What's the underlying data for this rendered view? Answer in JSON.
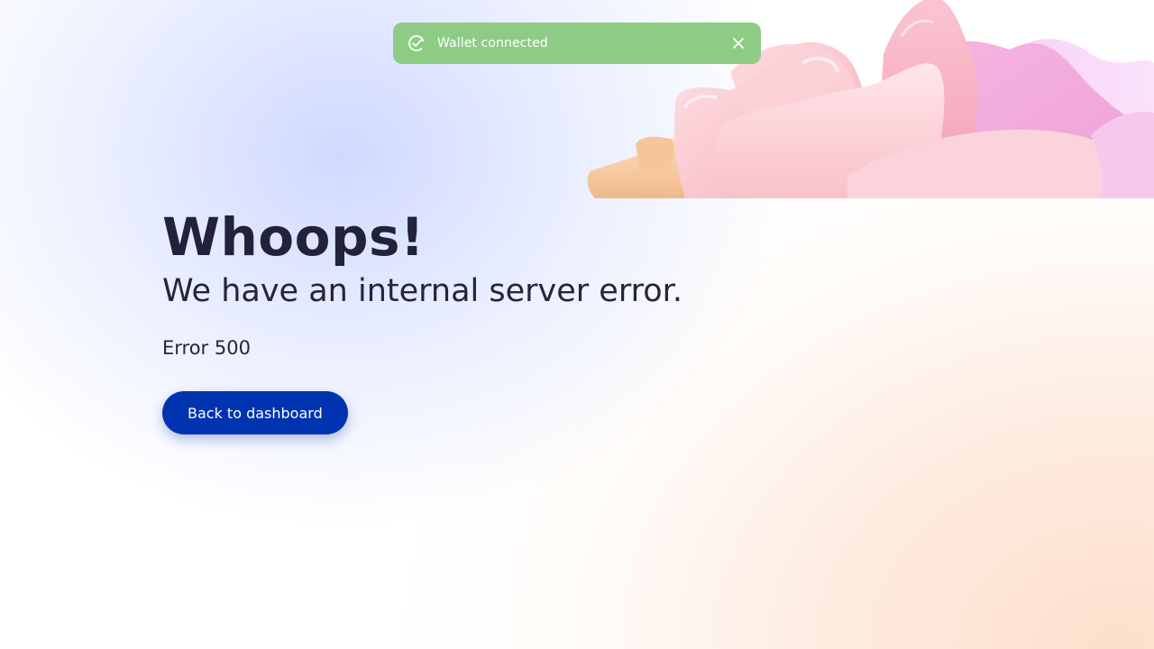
{
  "toast": {
    "message": "Wallet connected",
    "status_icon": "check-circle-icon",
    "close_icon": "close-icon",
    "color": "#8dcc83"
  },
  "error": {
    "title": "Whoops!",
    "subtitle": "We have an internal server error.",
    "code_label": "Error 500"
  },
  "actions": {
    "back_label": "Back to dashboard",
    "button_color": "#0033b0"
  },
  "decoration": {
    "image": "pink-peach-flower-illustration"
  }
}
